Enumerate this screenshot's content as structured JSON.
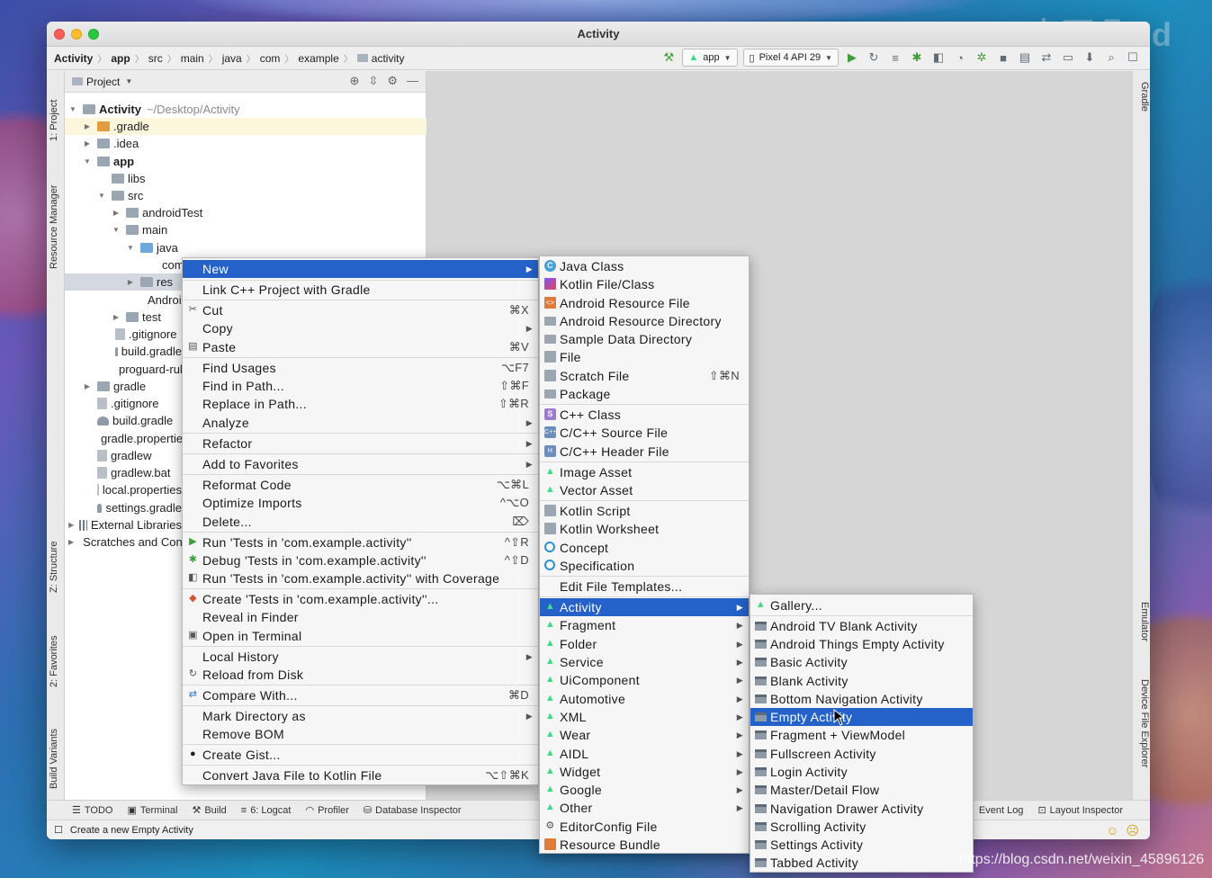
{
  "watermark": {
    "top": "李耳朵dd",
    "bottom": "https://blog.csdn.net/weixin_45896126"
  },
  "window": {
    "title": "Activity"
  },
  "breadcrumb": [
    "Activity",
    "app",
    "src",
    "main",
    "java",
    "com",
    "example",
    "activity"
  ],
  "toolbar": {
    "module": "app",
    "device": "Pixel 4 API 29"
  },
  "left_tabs": [
    "1: Project",
    "Resource Manager",
    "Z: Structure",
    "2: Favorites",
    "Build Variants"
  ],
  "right_tabs": [
    "Gradle",
    "Emulator",
    "Device File Explorer"
  ],
  "project_panel": {
    "title": "Project",
    "tree": [
      {
        "label": "Activity",
        "suffix": "~/Desktop/Activity",
        "bold": true
      },
      {
        "label": ".gradle"
      },
      {
        "label": ".idea"
      },
      {
        "label": "app",
        "bold": true
      },
      {
        "label": "libs"
      },
      {
        "label": "src"
      },
      {
        "label": "androidTest"
      },
      {
        "label": "main"
      },
      {
        "label": "java"
      },
      {
        "label": "com.example.activity"
      },
      {
        "label": "res"
      },
      {
        "label": "AndroidManifest.xml"
      },
      {
        "label": "test"
      },
      {
        "label": ".gitignore"
      },
      {
        "label": "build.gradle"
      },
      {
        "label": "proguard-rules.pro"
      },
      {
        "label": "gradle"
      },
      {
        "label": ".gitignore"
      },
      {
        "label": "build.gradle"
      },
      {
        "label": "gradle.properties"
      },
      {
        "label": "gradlew"
      },
      {
        "label": "gradlew.bat"
      },
      {
        "label": "local.properties"
      },
      {
        "label": "settings.gradle"
      },
      {
        "label": "External Libraries"
      },
      {
        "label": "Scratches and Consoles"
      }
    ]
  },
  "context_menu": [
    {
      "label": "New",
      "sub": true,
      "selected": true
    },
    {
      "label": "Link C++ Project with Gradle"
    },
    {
      "label": "Cut",
      "shortcut": "⌘X"
    },
    {
      "label": "Copy",
      "sub": true
    },
    {
      "label": "Paste",
      "shortcut": "⌘V"
    },
    {
      "label": "Find Usages",
      "shortcut": "⌥F7"
    },
    {
      "label": "Find in Path...",
      "shortcut": "⇧⌘F"
    },
    {
      "label": "Replace in Path...",
      "shortcut": "⇧⌘R"
    },
    {
      "label": "Analyze",
      "sub": true
    },
    {
      "label": "Refactor",
      "sub": true
    },
    {
      "label": "Add to Favorites",
      "sub": true
    },
    {
      "label": "Reformat Code",
      "shortcut": "⌥⌘L"
    },
    {
      "label": "Optimize Imports",
      "shortcut": "^⌥O"
    },
    {
      "label": "Delete...",
      "shortcut": "⌦"
    },
    {
      "label": "Run 'Tests in 'com.example.activity''",
      "shortcut": "^⇧R"
    },
    {
      "label": "Debug 'Tests in 'com.example.activity''",
      "shortcut": "^⇧D"
    },
    {
      "label": "Run 'Tests in 'com.example.activity'' with Coverage"
    },
    {
      "label": "Create 'Tests in 'com.example.activity''..."
    },
    {
      "label": "Reveal in Finder"
    },
    {
      "label": "Open in Terminal"
    },
    {
      "label": "Local History",
      "sub": true
    },
    {
      "label": "Reload from Disk"
    },
    {
      "label": "Compare With...",
      "shortcut": "⌘D"
    },
    {
      "label": "Mark Directory as",
      "sub": true
    },
    {
      "label": "Remove BOM"
    },
    {
      "label": "Create Gist..."
    },
    {
      "label": "Convert Java File to Kotlin File",
      "shortcut": "⌥⇧⌘K"
    }
  ],
  "new_menu": [
    {
      "label": "Java Class",
      "icon": "java-class-icon"
    },
    {
      "label": "Kotlin File/Class",
      "icon": "kotlin-icon"
    },
    {
      "label": "Android Resource File",
      "icon": "resource-file-icon"
    },
    {
      "label": "Android Resource Directory",
      "icon": "folder-icon"
    },
    {
      "label": "Sample Data Directory",
      "icon": "folder-icon"
    },
    {
      "label": "File",
      "icon": "file-icon"
    },
    {
      "label": "Scratch File",
      "icon": "scratch-icon",
      "shortcut": "⇧⌘N"
    },
    {
      "label": "Package",
      "icon": "package-icon"
    },
    {
      "label": "C++ Class",
      "icon": "cpp-class-icon"
    },
    {
      "label": "C/C++ Source File",
      "icon": "cpp-source-icon"
    },
    {
      "label": "C/C++ Header File",
      "icon": "cpp-header-icon"
    },
    {
      "label": "Image Asset",
      "icon": "android-icon"
    },
    {
      "label": "Vector Asset",
      "icon": "android-icon"
    },
    {
      "label": "Kotlin Script",
      "icon": "kotlin-icon"
    },
    {
      "label": "Kotlin Worksheet",
      "icon": "kotlin-icon"
    },
    {
      "label": "Concept",
      "icon": "concept-icon"
    },
    {
      "label": "Specification",
      "icon": "concept-icon"
    },
    {
      "label": "Edit File Templates..."
    },
    {
      "label": "Activity",
      "icon": "android-icon",
      "sub": true,
      "selected": true
    },
    {
      "label": "Fragment",
      "icon": "android-icon",
      "sub": true
    },
    {
      "label": "Folder",
      "icon": "android-icon",
      "sub": true
    },
    {
      "label": "Service",
      "icon": "android-icon",
      "sub": true
    },
    {
      "label": "UiComponent",
      "icon": "android-icon",
      "sub": true
    },
    {
      "label": "Automotive",
      "icon": "android-icon",
      "sub": true
    },
    {
      "label": "XML",
      "icon": "android-icon",
      "sub": true
    },
    {
      "label": "Wear",
      "icon": "android-icon",
      "sub": true
    },
    {
      "label": "AIDL",
      "icon": "android-icon",
      "sub": true
    },
    {
      "label": "Widget",
      "icon": "android-icon",
      "sub": true
    },
    {
      "label": "Google",
      "icon": "android-icon",
      "sub": true
    },
    {
      "label": "Other",
      "icon": "android-icon",
      "sub": true
    },
    {
      "label": "EditorConfig File",
      "icon": "gear-icon"
    },
    {
      "label": "Resource Bundle",
      "icon": "bundle-icon"
    }
  ],
  "activity_menu": [
    {
      "label": "Gallery..."
    },
    {
      "label": "Android TV Blank Activity"
    },
    {
      "label": "Android Things Empty Activity"
    },
    {
      "label": "Basic Activity"
    },
    {
      "label": "Blank Activity"
    },
    {
      "label": "Bottom Navigation Activity"
    },
    {
      "label": "Empty Activity",
      "selected": true
    },
    {
      "label": "Fragment + ViewModel"
    },
    {
      "label": "Fullscreen Activity"
    },
    {
      "label": "Login Activity"
    },
    {
      "label": "Master/Detail Flow"
    },
    {
      "label": "Navigation Drawer Activity"
    },
    {
      "label": "Scrolling Activity"
    },
    {
      "label": "Settings Activity"
    },
    {
      "label": "Tabbed Activity"
    }
  ],
  "bottom_tools": [
    "TODO",
    "Terminal",
    "Build",
    "6: Logcat",
    "Profiler",
    "Database Inspector"
  ],
  "bottom_tools_right": [
    "Event Log",
    "Layout Inspector"
  ],
  "status": "Create a new Empty Activity",
  "colors": {
    "selection": "#2461c9",
    "android_green": "#3ddc84"
  }
}
